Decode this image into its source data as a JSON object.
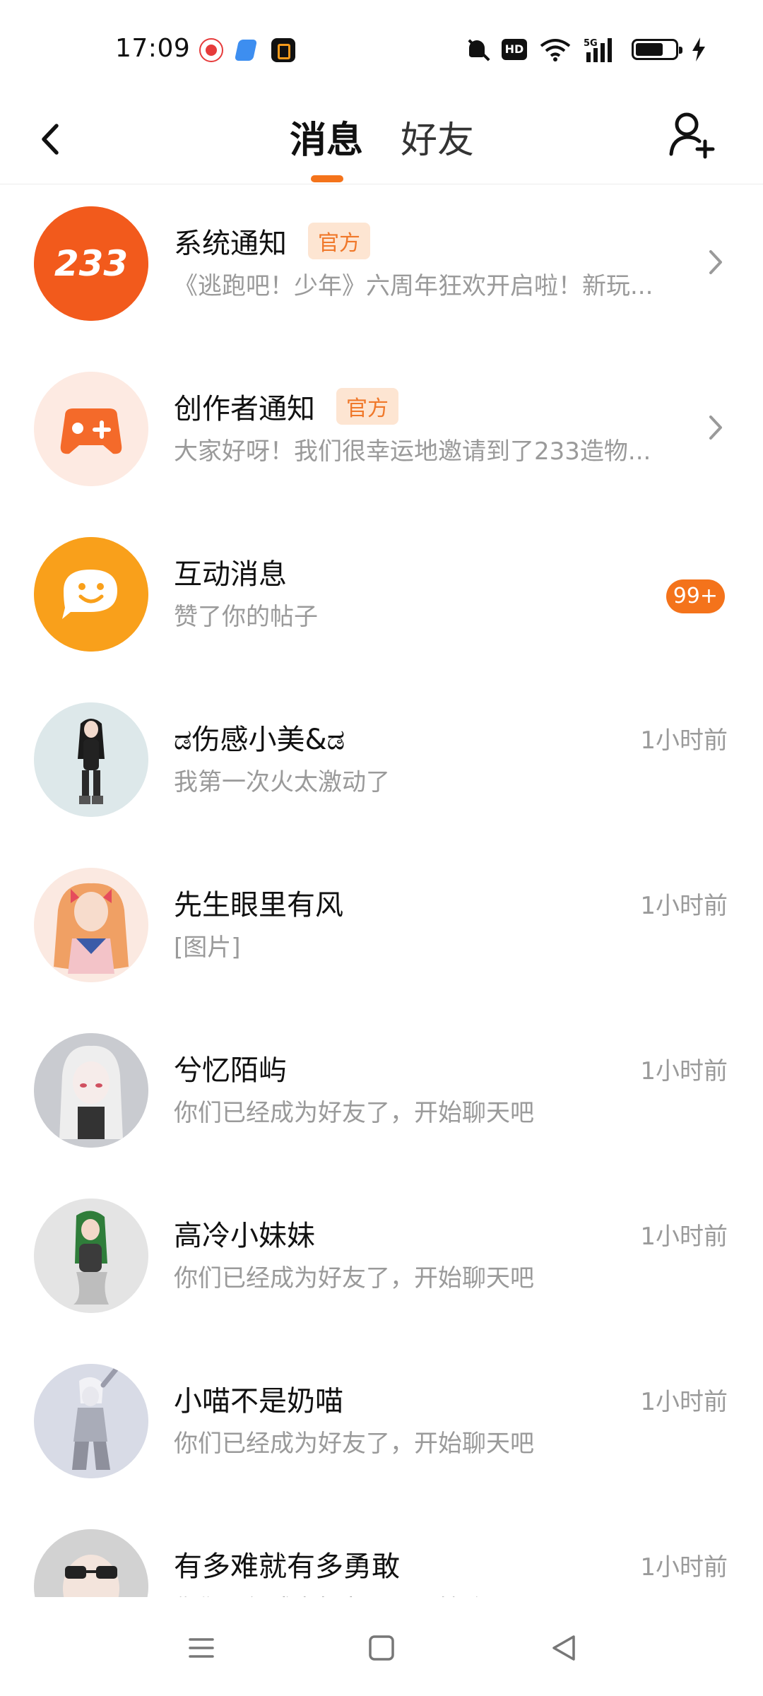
{
  "status_bar": {
    "time": "17:09",
    "icons": [
      "app-icon-red",
      "app-icon-blue",
      "app-icon-orange",
      "bell-off-icon",
      "hd-icon",
      "wifi-icon",
      "signal-5g-icon",
      "battery-icon",
      "charging-icon"
    ],
    "hd_label": "HD",
    "network_label": "5G"
  },
  "header": {
    "back_icon": "chevron-left-icon",
    "tabs": [
      {
        "label": "消息",
        "active": true
      },
      {
        "label": "好友",
        "active": false
      }
    ],
    "add_friend_icon": "add-friend-icon",
    "accent_color": "#f4731b"
  },
  "messages": [
    {
      "name": "系统通知",
      "badge": "官方",
      "preview": "《逃跑吧！少年》六周年狂欢开启啦！新玩...",
      "trailing": "chevron-right-icon",
      "avatar": "logo-233"
    },
    {
      "name": "创作者通知",
      "badge": "官方",
      "preview": "大家好呀！我们很幸运地邀请到了233造物...",
      "trailing": "chevron-right-icon",
      "avatar": "gamepad-icon"
    },
    {
      "name": "互动消息",
      "preview": "赞了你的帖子",
      "count": "99+",
      "avatar": "chat-bubble-icon"
    },
    {
      "name": "ಡ伤感小美&ಡ",
      "preview": "我第一次火太激动了",
      "time": "1小时前",
      "avatar": "user-avatar"
    },
    {
      "name": "先生眼里有风",
      "preview": "[图片]",
      "time": "1小时前",
      "avatar": "user-avatar"
    },
    {
      "name": "兮忆陌屿",
      "preview": "你们已经成为好友了，开始聊天吧",
      "time": "1小时前",
      "avatar": "user-avatar"
    },
    {
      "name": "高冷小妹妹",
      "preview": "你们已经成为好友了，开始聊天吧",
      "time": "1小时前",
      "avatar": "user-avatar"
    },
    {
      "name": "小喵不是奶喵",
      "preview": "你们已经成为好友了，开始聊天吧",
      "time": "1小时前",
      "avatar": "user-avatar"
    },
    {
      "name": "有多难就有多勇敢",
      "preview": "你们已经成为好友了，开始聊天吧",
      "time": "1小时前",
      "avatar": "user-avatar"
    }
  ],
  "logo_text": "233",
  "nav_bar": {
    "buttons": [
      "menu-icon",
      "home-icon",
      "back-triangle-icon"
    ]
  }
}
